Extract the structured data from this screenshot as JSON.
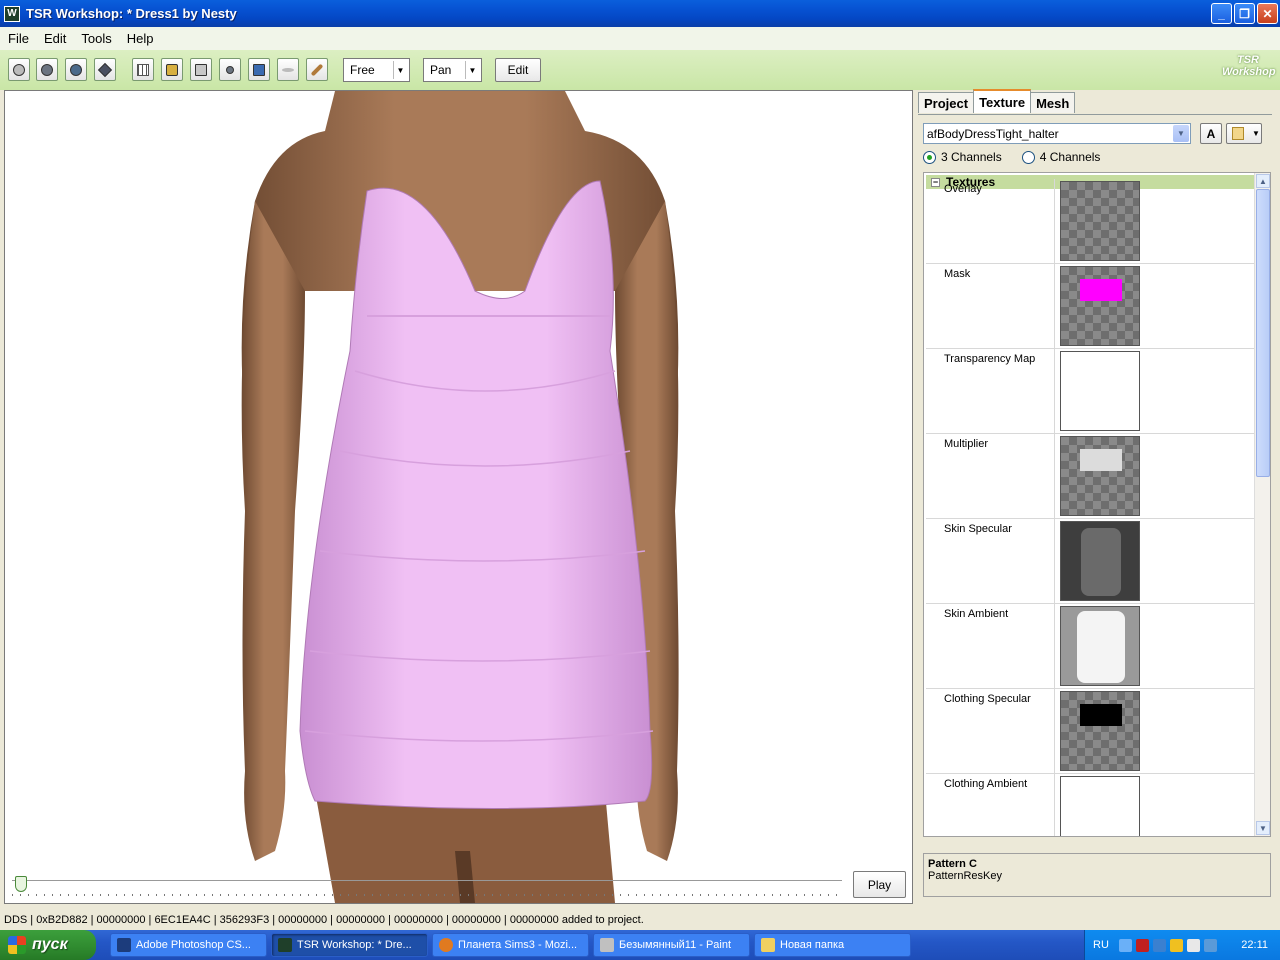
{
  "window": {
    "title": "TSR Workshop: * Dress1 by Nesty",
    "app_icon": "W"
  },
  "menu": [
    "File",
    "Edit",
    "Tools",
    "Help"
  ],
  "toolbar": {
    "mode_select": "Free",
    "camera_select": "Pan",
    "edit_label": "Edit",
    "logo_line1": "TSR",
    "logo_line2": "Workshop"
  },
  "viewport": {
    "play_label": "Play"
  },
  "panel": {
    "tabs": [
      "Project",
      "Texture",
      "Mesh"
    ],
    "active_tab": "Texture",
    "mesh_select": "afBodyDressTight_halter",
    "a_button": "A",
    "channels": {
      "three": "3 Channels",
      "four": "4 Channels",
      "selected": "3 Channels"
    },
    "textures_header": "Textures",
    "textures": [
      {
        "label": "Overlay"
      },
      {
        "label": "Mask"
      },
      {
        "label": "Transparency Map"
      },
      {
        "label": "Multiplier"
      },
      {
        "label": "Skin Specular"
      },
      {
        "label": "Skin Ambient"
      },
      {
        "label": "Clothing Specular"
      },
      {
        "label": "Clothing Ambient"
      }
    ],
    "description": {
      "title": "Pattern C",
      "subtitle": "PatternResKey"
    }
  },
  "status": "DDS | 0xB2D882 | 00000000 | 6EC1EA4C | 356293F3 | 00000000 | 00000000 | 00000000 | 00000000 | 00000000 added to project.",
  "taskbar": {
    "start_label": "пуск",
    "tasks": [
      {
        "label": "Adobe Photoshop CS...",
        "icon_color": "#1c3c7c"
      },
      {
        "label": "TSR Workshop: * Dre...",
        "icon_color": "#1f3f2a"
      },
      {
        "label": "Планета Sims3 - Mozi...",
        "icon_color": "#e07a20"
      },
      {
        "label": "Безымянный11 - Paint",
        "icon_color": "#c0c0c0"
      },
      {
        "label": "Новая папка",
        "icon_color": "#f0d060"
      }
    ],
    "language": "RU",
    "clock": "22:11"
  },
  "colors": {
    "dress": "#e8b0ee",
    "skin": "#9a6a4a",
    "accent_green": "#c9e6a6"
  }
}
